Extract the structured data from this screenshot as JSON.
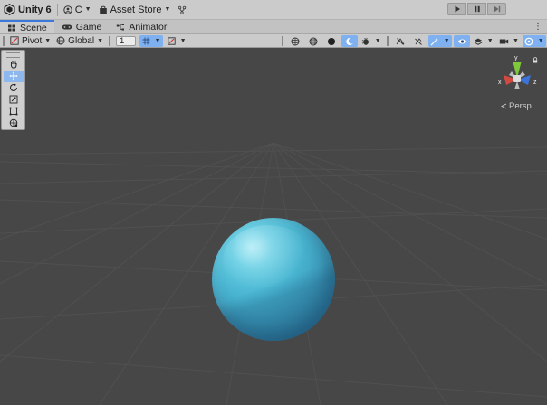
{
  "topbar": {
    "app_title": "Unity 6",
    "account_label": "C",
    "asset_store_label": "Asset Store"
  },
  "tabs": [
    {
      "label": "Scene",
      "active": true,
      "icon": "scene-icon"
    },
    {
      "label": "Game",
      "active": false,
      "icon": "gamepad-icon"
    },
    {
      "label": "Animator",
      "active": false,
      "icon": "animator-icon"
    }
  ],
  "scene_toolbar": {
    "pivot_label": "Pivot",
    "global_label": "Global",
    "grid_snap_value": "1"
  },
  "viewport": {
    "persp_label": "Persp",
    "gizmo": {
      "x_label": "x",
      "y_label": "y",
      "z_label": "z"
    }
  },
  "tool_palette": [
    "hand-tool-icon",
    "move-tool-icon",
    "rotate-tool-icon",
    "scale-tool-icon",
    "rect-tool-icon",
    "transform-tool-icon"
  ],
  "colors": {
    "accent": "#3a79d9",
    "active_button": "#7fb0ef",
    "viewport_bg": "#474747",
    "sphere": "#48b4d0",
    "gizmo_x": "#d24a3f",
    "gizmo_y": "#7ec83a",
    "gizmo_z": "#3d73d6"
  }
}
